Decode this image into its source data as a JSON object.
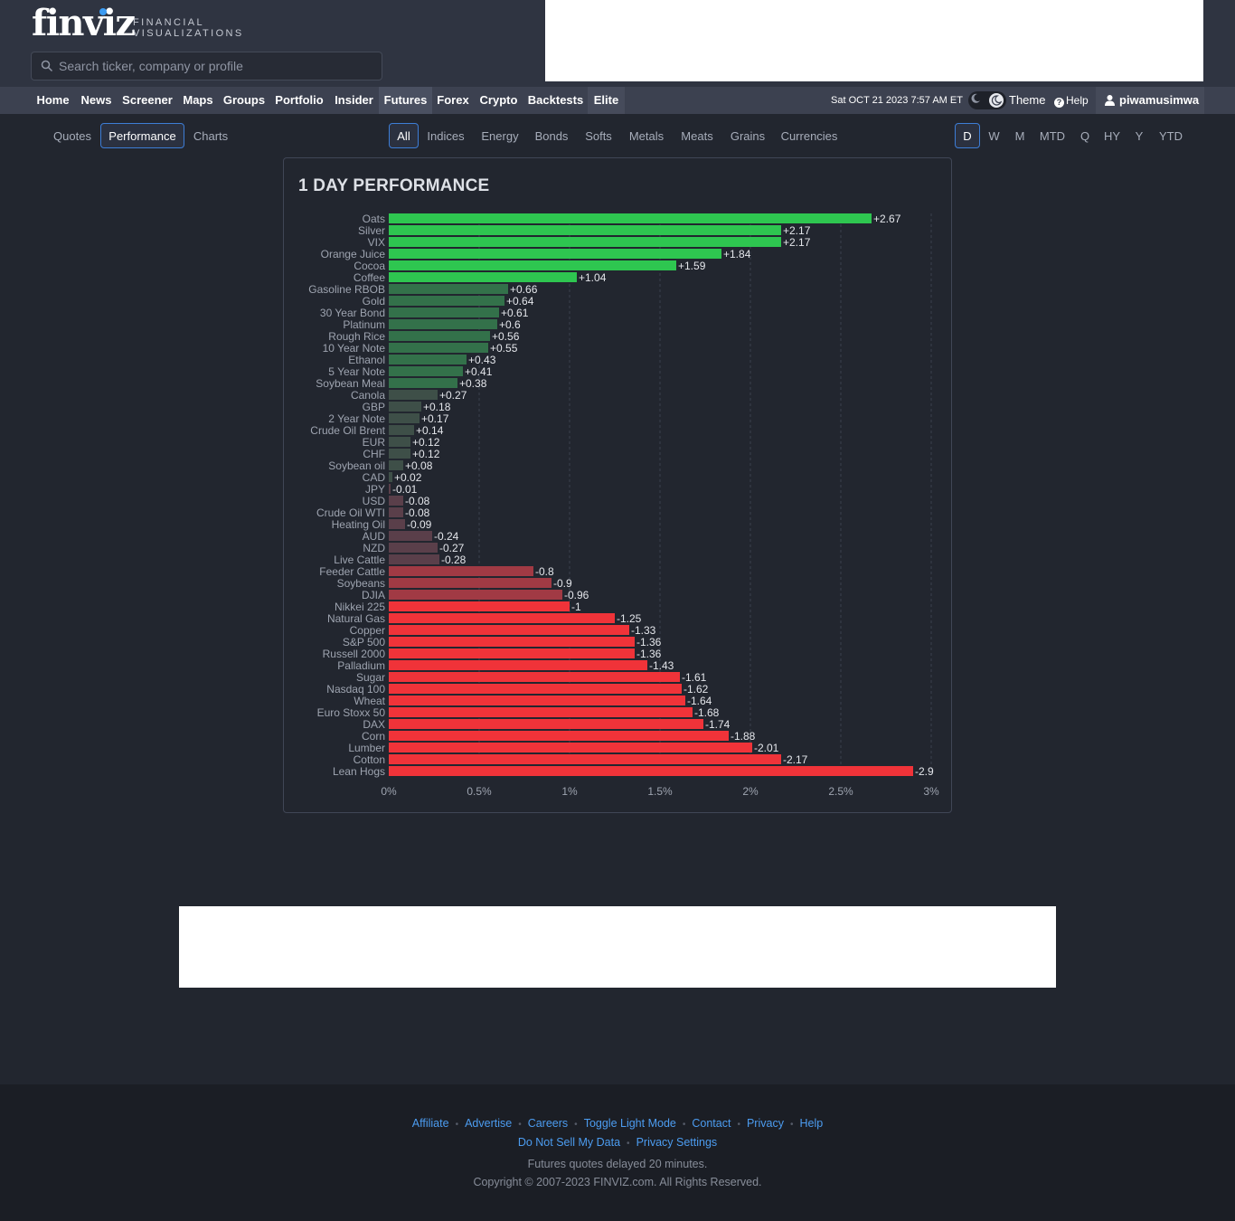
{
  "brand": {
    "name": "finviz",
    "tagline_1": "FINANCIAL",
    "tagline_2": "VISUALIZATIONS"
  },
  "search": {
    "placeholder": "Search ticker, company or profile",
    "value": ""
  },
  "nav": {
    "items": [
      "Home",
      "News",
      "Screener",
      "Maps",
      "Groups",
      "Portfolio",
      "Insider",
      "Futures",
      "Forex",
      "Crypto",
      "Backtests",
      "Elite"
    ],
    "active": "Futures",
    "datetime": "Sat OCT 21 2023 7:57 AM ET",
    "theme_label": "Theme",
    "help_label": "Help",
    "username": "piwamusimwa"
  },
  "view_tabs": {
    "items": [
      "Quotes",
      "Performance",
      "Charts"
    ],
    "selected": "Performance"
  },
  "group_tabs": {
    "items": [
      "All",
      "Indices",
      "Energy",
      "Bonds",
      "Softs",
      "Metals",
      "Meats",
      "Grains",
      "Currencies"
    ],
    "selected": "All"
  },
  "period_tabs": {
    "items": [
      "D",
      "W",
      "M",
      "MTD",
      "Q",
      "HY",
      "Y",
      "YTD"
    ],
    "selected": "D"
  },
  "chart_title": "1 DAY PERFORMANCE",
  "chart_data": {
    "type": "bar",
    "orientation": "horizontal",
    "title": "1 DAY PERFORMANCE",
    "categories": [
      "Oats",
      "Silver",
      "VIX",
      "Orange Juice",
      "Cocoa",
      "Coffee",
      "Gasoline RBOB",
      "Gold",
      "30 Year Bond",
      "Platinum",
      "Rough Rice",
      "10 Year Note",
      "Ethanol",
      "5 Year Note",
      "Soybean Meal",
      "Canola",
      "GBP",
      "2 Year Note",
      "Crude Oil Brent",
      "EUR",
      "CHF",
      "Soybean oil",
      "CAD",
      "JPY",
      "USD",
      "Crude Oil WTI",
      "Heating Oil",
      "AUD",
      "NZD",
      "Live Cattle",
      "Feeder Cattle",
      "Soybeans",
      "DJIA",
      "Nikkei 225",
      "Natural Gas",
      "Copper",
      "S&P 500",
      "Russell 2000",
      "Palladium",
      "Sugar",
      "Nasdaq 100",
      "Wheat",
      "Euro Stoxx 50",
      "DAX",
      "Corn",
      "Lumber",
      "Cotton",
      "Lean Hogs"
    ],
    "values": [
      2.67,
      2.17,
      2.17,
      1.84,
      1.59,
      1.04,
      0.66,
      0.64,
      0.61,
      0.6,
      0.56,
      0.55,
      0.43,
      0.41,
      0.38,
      0.27,
      0.18,
      0.17,
      0.14,
      0.12,
      0.12,
      0.08,
      0.02,
      -0.01,
      -0.08,
      -0.08,
      -0.09,
      -0.24,
      -0.27,
      -0.28,
      -0.8,
      -0.9,
      -0.96,
      -1,
      -1.25,
      -1.33,
      -1.36,
      -1.36,
      -1.43,
      -1.61,
      -1.62,
      -1.64,
      -1.68,
      -1.74,
      -1.88,
      -2.01,
      -2.17,
      -2.9
    ],
    "value_labels": [
      "+2.67",
      "+2.17",
      "+2.17",
      "+1.84",
      "+1.59",
      "+1.04",
      "+0.66",
      "+0.64",
      "+0.61",
      "+0.6",
      "+0.56",
      "+0.55",
      "+0.43",
      "+0.41",
      "+0.38",
      "+0.27",
      "+0.18",
      "+0.17",
      "+0.14",
      "+0.12",
      "+0.12",
      "+0.08",
      "+0.02",
      "-0.01",
      "-0.08",
      "-0.08",
      "-0.09",
      "-0.24",
      "-0.27",
      "-0.28",
      "-0.8",
      "-0.9",
      "-0.96",
      "-1",
      "-1.25",
      "-1.33",
      "-1.36",
      "-1.36",
      "-1.43",
      "-1.61",
      "-1.62",
      "-1.64",
      "-1.68",
      "-1.74",
      "-1.88",
      "-2.01",
      "-2.17",
      "-2.9"
    ],
    "x_ticks": [
      "0%",
      "0.5%",
      "1%",
      "1.5%",
      "2%",
      "2.5%",
      "3%"
    ],
    "x_tick_values": [
      0,
      0.5,
      1,
      1.5,
      2,
      2.5,
      3
    ],
    "xlim": [
      0,
      3
    ],
    "bar_length": "absolute value",
    "grid": "vertical dashed",
    "colors": {
      "positive_strong": "#2ec650",
      "positive_mid": "#33714a",
      "positive_weak": "#3e4f48",
      "negative_weak": "#5a3f4a",
      "negative_mid": "#a13a44",
      "negative_strong": "#f03339"
    }
  },
  "footer": {
    "links_row1": [
      "Affiliate",
      "Advertise",
      "Careers",
      "Toggle Light Mode",
      "Contact",
      "Privacy",
      "Help"
    ],
    "links_row2": [
      "Do Not Sell My Data",
      "Privacy Settings"
    ],
    "delay_note": "Futures quotes delayed 20 minutes.",
    "copyright": "Copyright © 2007-2023 FINVIZ.com. All Rights Reserved."
  }
}
